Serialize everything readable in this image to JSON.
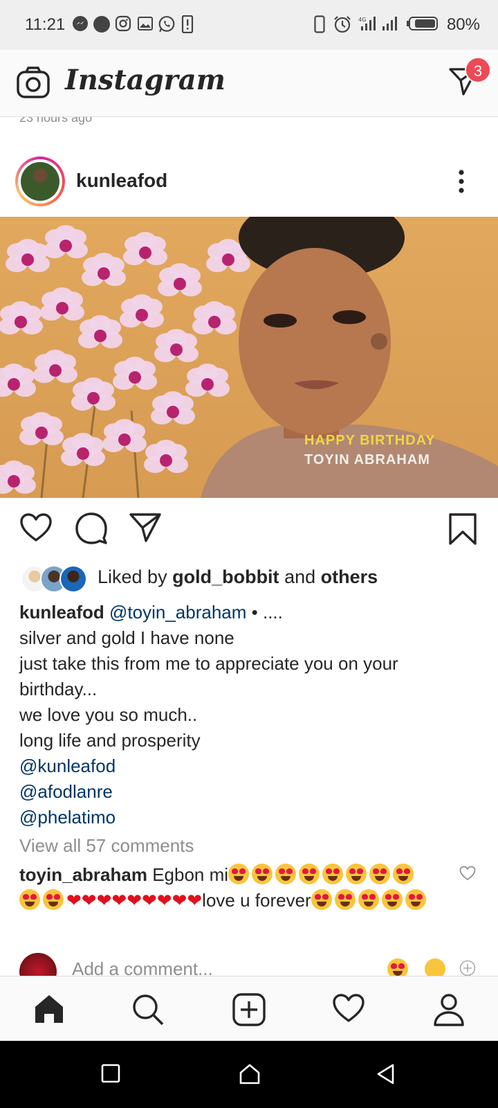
{
  "status_bar": {
    "time": "11:21",
    "battery": "80%",
    "left_icons": [
      "messenger-icon",
      "dot-icon",
      "instagram-icon",
      "gallery-icon",
      "whatsapp-icon",
      "alert-icon"
    ],
    "right_icons": [
      "phone-icon",
      "alarm-icon",
      "signal-icon",
      "signal-icon",
      "battery-icon"
    ]
  },
  "header": {
    "app_name": "Instagram",
    "camera_icon": "camera-icon",
    "direct_icon": "direct-message-icon",
    "direct_badge": "3"
  },
  "previous_post": {
    "time": "23 hours ago"
  },
  "post": {
    "username": "kunleafod",
    "more_icon": "more-vertical-icon",
    "image_text": {
      "line1": "HAPPY BIRTHDAY",
      "line2": "TOYIN ABRAHAM"
    },
    "actions": {
      "like_icon": "heart-outline-icon",
      "comment_icon": "comment-icon",
      "share_icon": "share-icon",
      "save_icon": "bookmark-icon"
    },
    "likes": {
      "prefix": "Liked by",
      "user": "gold_bobbit",
      "and": "and",
      "others": "others"
    },
    "caption": {
      "username": "kunleafod",
      "mention": "@toyin_abraham",
      "tail": "• ....",
      "lines": [
        "silver and gold I have none",
        "just take this from me to appreciate you on your",
        "birthday...",
        "we love you so much..",
        "long life and prosperity"
      ],
      "tags": [
        "@kunleafod",
        "@afodlanre",
        "@phelatimo"
      ]
    },
    "view_all_comments": "View all 57 comments",
    "top_comment": {
      "username": "toyin_abraham",
      "text_start": "Egbon mi",
      "text_mid": "love u forever"
    },
    "add_comment_placeholder": "Add a comment..."
  },
  "bottom_nav": [
    "home-icon",
    "search-icon",
    "new-post-icon",
    "activity-icon",
    "profile-icon"
  ],
  "system_nav": [
    "recents-icon",
    "home-icon",
    "back-icon"
  ],
  "colors": {
    "badge": "#ed4956",
    "mention": "#003569",
    "muted": "#8e8e8e",
    "text": "#262626",
    "image_text_yellow": "#f2d640"
  }
}
